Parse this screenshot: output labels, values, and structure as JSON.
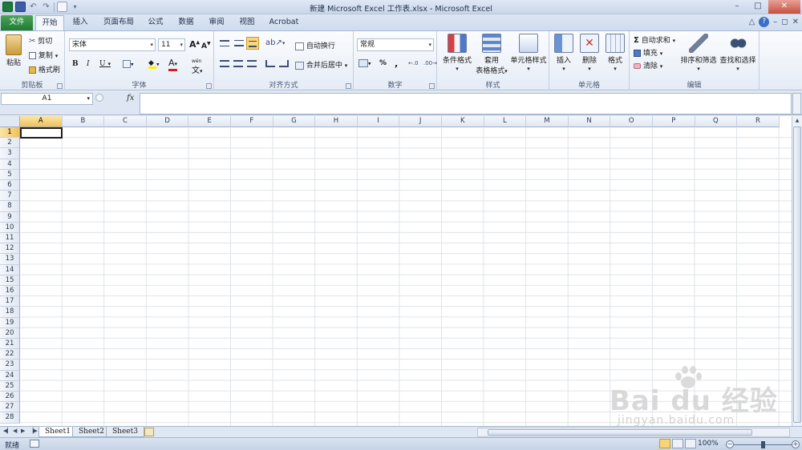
{
  "window": {
    "title": "新建 Microsoft Excel 工作表.xlsx - Microsoft Excel",
    "min": "–",
    "max": "□",
    "close": "✕"
  },
  "ribbon_tabs": [
    "文件",
    "开始",
    "插入",
    "页面布局",
    "公式",
    "数据",
    "审阅",
    "视图",
    "Acrobat"
  ],
  "clipboard": {
    "paste": "粘贴",
    "cut": "剪切",
    "copy": "复制",
    "format_painter": "格式刷",
    "label": "剪贴板"
  },
  "font": {
    "name": "宋体",
    "size": "11",
    "bold": "B",
    "italic": "I",
    "underline": "U",
    "grow": "A",
    "shrink": "A",
    "font_color": "A",
    "phonetic": "wén",
    "label": "字体"
  },
  "alignment": {
    "wrap": "自动换行",
    "merge": "合并后居中",
    "label": "对齐方式"
  },
  "number": {
    "format": "常规",
    "percent": "%",
    "comma": ",",
    "label": "数字"
  },
  "styles": {
    "conditional": "条件格式",
    "table_line1": "套用",
    "table_line2": "表格格式",
    "cell_styles": "单元格样式",
    "label": "样式"
  },
  "cells_group": {
    "insert": "插入",
    "delete": "删除",
    "format": "格式",
    "label": "单元格"
  },
  "editing": {
    "autosum": "自动求和",
    "fill": "填充",
    "clear": "清除",
    "sort": "排序和筛选",
    "find": "查找和选择",
    "label": "编辑"
  },
  "formula_bar": {
    "name_box": "A1",
    "fx": "fx"
  },
  "columns": [
    "A",
    "B",
    "C",
    "D",
    "E",
    "F",
    "G",
    "H",
    "I",
    "J",
    "K",
    "L",
    "M",
    "N",
    "O",
    "P",
    "Q",
    "R"
  ],
  "rows": [
    "1",
    "2",
    "3",
    "4",
    "5",
    "6",
    "7",
    "8",
    "9",
    "10",
    "11",
    "12",
    "13",
    "14",
    "15",
    "16",
    "17",
    "18",
    "19",
    "20",
    "21",
    "22",
    "23",
    "24",
    "25",
    "26",
    "27",
    "28"
  ],
  "sheets": [
    "Sheet1",
    "Sheet2",
    "Sheet3"
  ],
  "status": {
    "ready": "就绪",
    "zoom": "100%",
    "zoom_minus": "−",
    "zoom_plus": "+"
  },
  "watermark": {
    "brand": "Bai du 经验",
    "url": "jingyan.baidu.com"
  },
  "colors": {
    "file_tab": "#1f7b33",
    "selection_header": "#f1c15a",
    "grid_line": "#dfe3e8"
  }
}
